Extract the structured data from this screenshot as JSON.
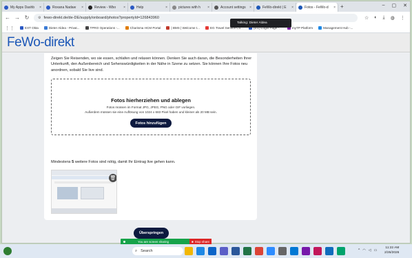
{
  "tabs": [
    {
      "label": "My Apps Dashb",
      "color": "#2b59c3"
    },
    {
      "label": "Roxana Nadaw",
      "color": "#2b59c3"
    },
    {
      "label": "Review - Wbo",
      "color": "#222222"
    },
    {
      "label": "Help",
      "color": "#2b59c3"
    },
    {
      "label": "pictures with h",
      "color": "#888888"
    },
    {
      "label": "Account settings",
      "color": "#555555"
    },
    {
      "label": "FeWo-direkt | E",
      "color": "#1c57b7"
    },
    {
      "label": "Fotos - FeWo-d",
      "color": "#1c57b7",
      "active": true
    }
  ],
  "address": {
    "url": "fewo-direkt.de/de-DE/supply/onboard/photos?propertyId=126843960"
  },
  "bookmarks": [
    {
      "label": "EXT Okta",
      "color": "#2b59c3"
    },
    {
      "label": "Dieter Aldea - Privat...",
      "color": "#3a7bd5"
    },
    {
      "label": "TPRO Operations -...",
      "color": "#444444"
    },
    {
      "label": "Charisma HCM Portal",
      "color": "#e07b00"
    },
    {
      "label": "| BMS | Welcome t...",
      "color": "#c0392b"
    },
    {
      "label": "EG Travel Service Co...",
      "color": "#e53935"
    },
    {
      "label": "(EG) Login Page -...",
      "color": "#2b59c3"
    },
    {
      "label": "myTP Platform",
      "color": "#7b1fa2"
    },
    {
      "label": "Management Hub -...",
      "color": "#1e88e5"
    }
  ],
  "tooltip": "Talking: Dieter Aldea",
  "site": {
    "logo": "FeWo-direkt"
  },
  "content": {
    "intro": "Zeigen Sie Reisenden, wo sie essen, schlafen und relaxen können. Denken Sie auch daran, die Besonderheiten Ihrer Unterkunft, den Außenbereich und Sehenswürdigkeiten in der Nähe in Szene zu setzen. Sie können Ihre Fotos neu anordnen, sobald Sie live sind.",
    "dropzone_title": "Fotos hierherziehen und ablegen",
    "dropzone_line1": "Fotos müssen im Format JPG, JPEG, PNG oder GIF vorliegen.",
    "dropzone_line2": "Außerdem müssen sie eine Auflösung von 1024 x 683 Pixel haben und kleiner als 20 MB sein.",
    "add_button": "Fotos hinzufügen",
    "min_prefix": "Mindestens ",
    "min_count": "5",
    "min_suffix": " weitere Fotos sind nötig, damit Ihr Eintrag live gehen kann.",
    "skip_button": "Überspringen"
  },
  "sharebar": {
    "text": "You are screen sharing",
    "stop": "Stop share"
  },
  "taskbar": {
    "search": "Search",
    "time": "11:22 AM",
    "date": "2/26/2026",
    "icons": [
      {
        "name": "file-explorer-icon",
        "color": "#f2b705"
      },
      {
        "name": "edge-icon",
        "color": "#1e88e5"
      },
      {
        "name": "outlook-icon",
        "color": "#0a64c8"
      },
      {
        "name": "teams-icon",
        "color": "#5b5fc7"
      },
      {
        "name": "word-icon",
        "color": "#2b579a"
      },
      {
        "name": "excel-icon",
        "color": "#217346"
      },
      {
        "name": "chrome-icon",
        "color": "#db4437"
      },
      {
        "name": "zoom-icon",
        "color": "#2d8cff"
      },
      {
        "name": "settings-icon",
        "color": "#666666"
      },
      {
        "name": "store-icon",
        "color": "#0078d4"
      },
      {
        "name": "onenote-icon",
        "color": "#7719aa"
      },
      {
        "name": "snip-icon",
        "color": "#c2185b"
      },
      {
        "name": "mail-icon",
        "color": "#0f6cbd"
      },
      {
        "name": "maps-icon",
        "color": "#00a36c"
      }
    ]
  }
}
